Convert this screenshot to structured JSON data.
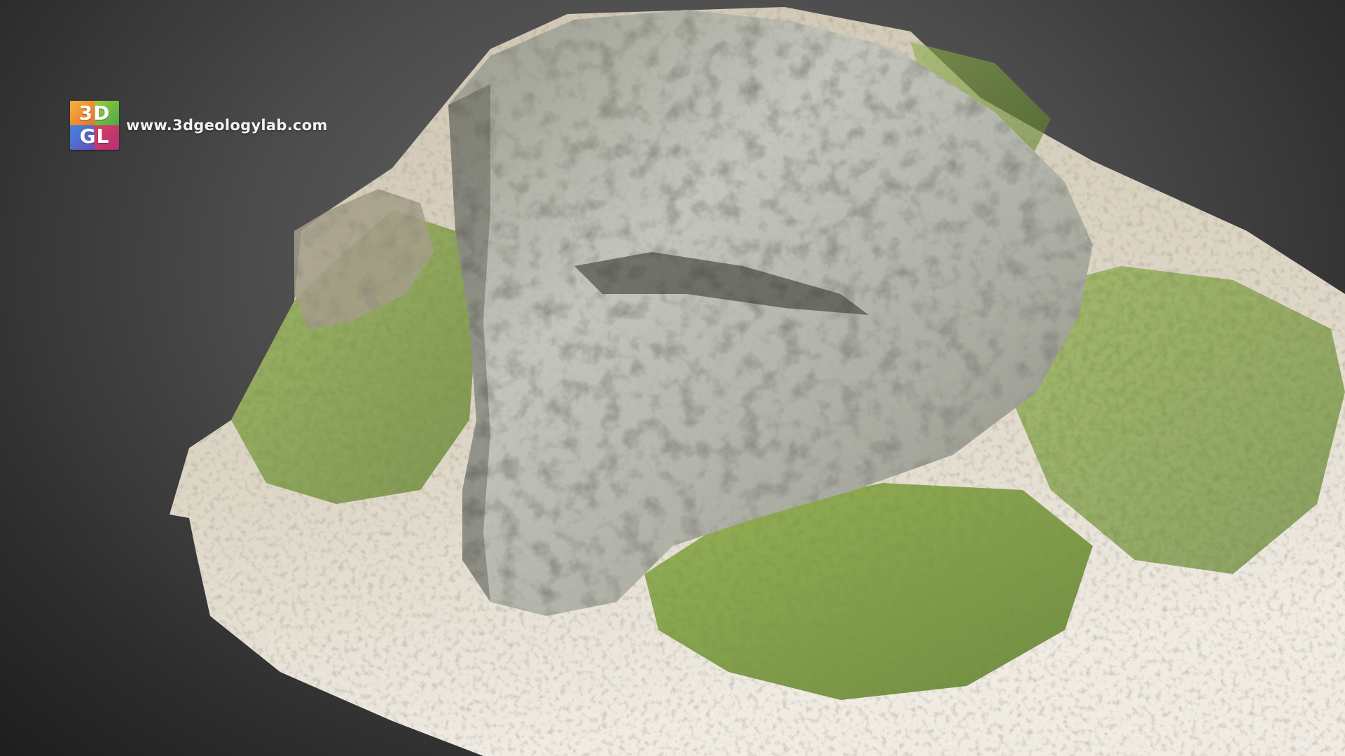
{
  "watermark": {
    "logo_line1": "3D",
    "logo_line2": "GL",
    "url": "www.3dgeologylab.com"
  },
  "scene": {
    "subject_icon": "rock-outcrop-3d-model",
    "colors": {
      "background_light": "#6a6a6a",
      "background_dark": "#1e1e1e",
      "rock_light": "#c9ccc4",
      "rock_mid": "#8d8f86",
      "rock_dark": "#4a4a40",
      "grass": "#7fa03a",
      "grass_dark": "#4f6a24",
      "ground": "#d9d2c2",
      "soil": "#a89576"
    }
  }
}
